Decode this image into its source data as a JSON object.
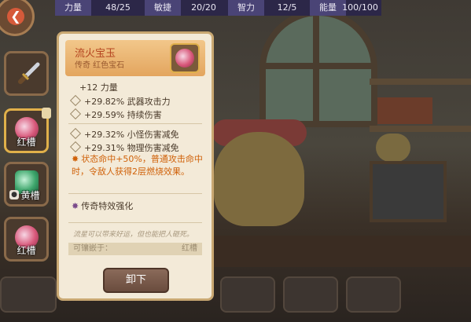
{
  "stats": [
    {
      "label": "力量",
      "value": "48/25"
    },
    {
      "label": "敏捷",
      "value": "20/20"
    },
    {
      "label": "智力",
      "value": "12/5"
    },
    {
      "label": "能量",
      "value": "100/100"
    }
  ],
  "slots": [
    {
      "icon": "sword-icon",
      "label": ""
    },
    {
      "icon": "red-gem-icon",
      "label": "红槽"
    },
    {
      "icon": "green-gem-icon",
      "label": "黄槽",
      "locked": true
    },
    {
      "icon": "red-gem-icon",
      "label": "红槽"
    }
  ],
  "item": {
    "name": "流火宝玉",
    "subtitle": "传奇 红色宝石",
    "base_stat": "+12 力量",
    "stats_a": [
      "+29.82% 武器攻击力",
      "+29.59% 持续伤害"
    ],
    "stats_b": [
      "+29.32% 小怪伤害减免",
      "+29.31% 物理伤害减免"
    ],
    "special": "状态命中+50%，普通攻击命中时，令敌人获得2层燃烧效果。",
    "enhance": "传奇特效强化",
    "flavor": "流星可以带来好运，但也能把人砸死。",
    "inlay_label": "可镶嵌于：",
    "inlay_value": "红槽",
    "unequip_label": "卸下"
  },
  "colors": {
    "legendary_name": "#b54520",
    "special_text": "#d0620a",
    "panel_bg": "#f3ead8"
  }
}
